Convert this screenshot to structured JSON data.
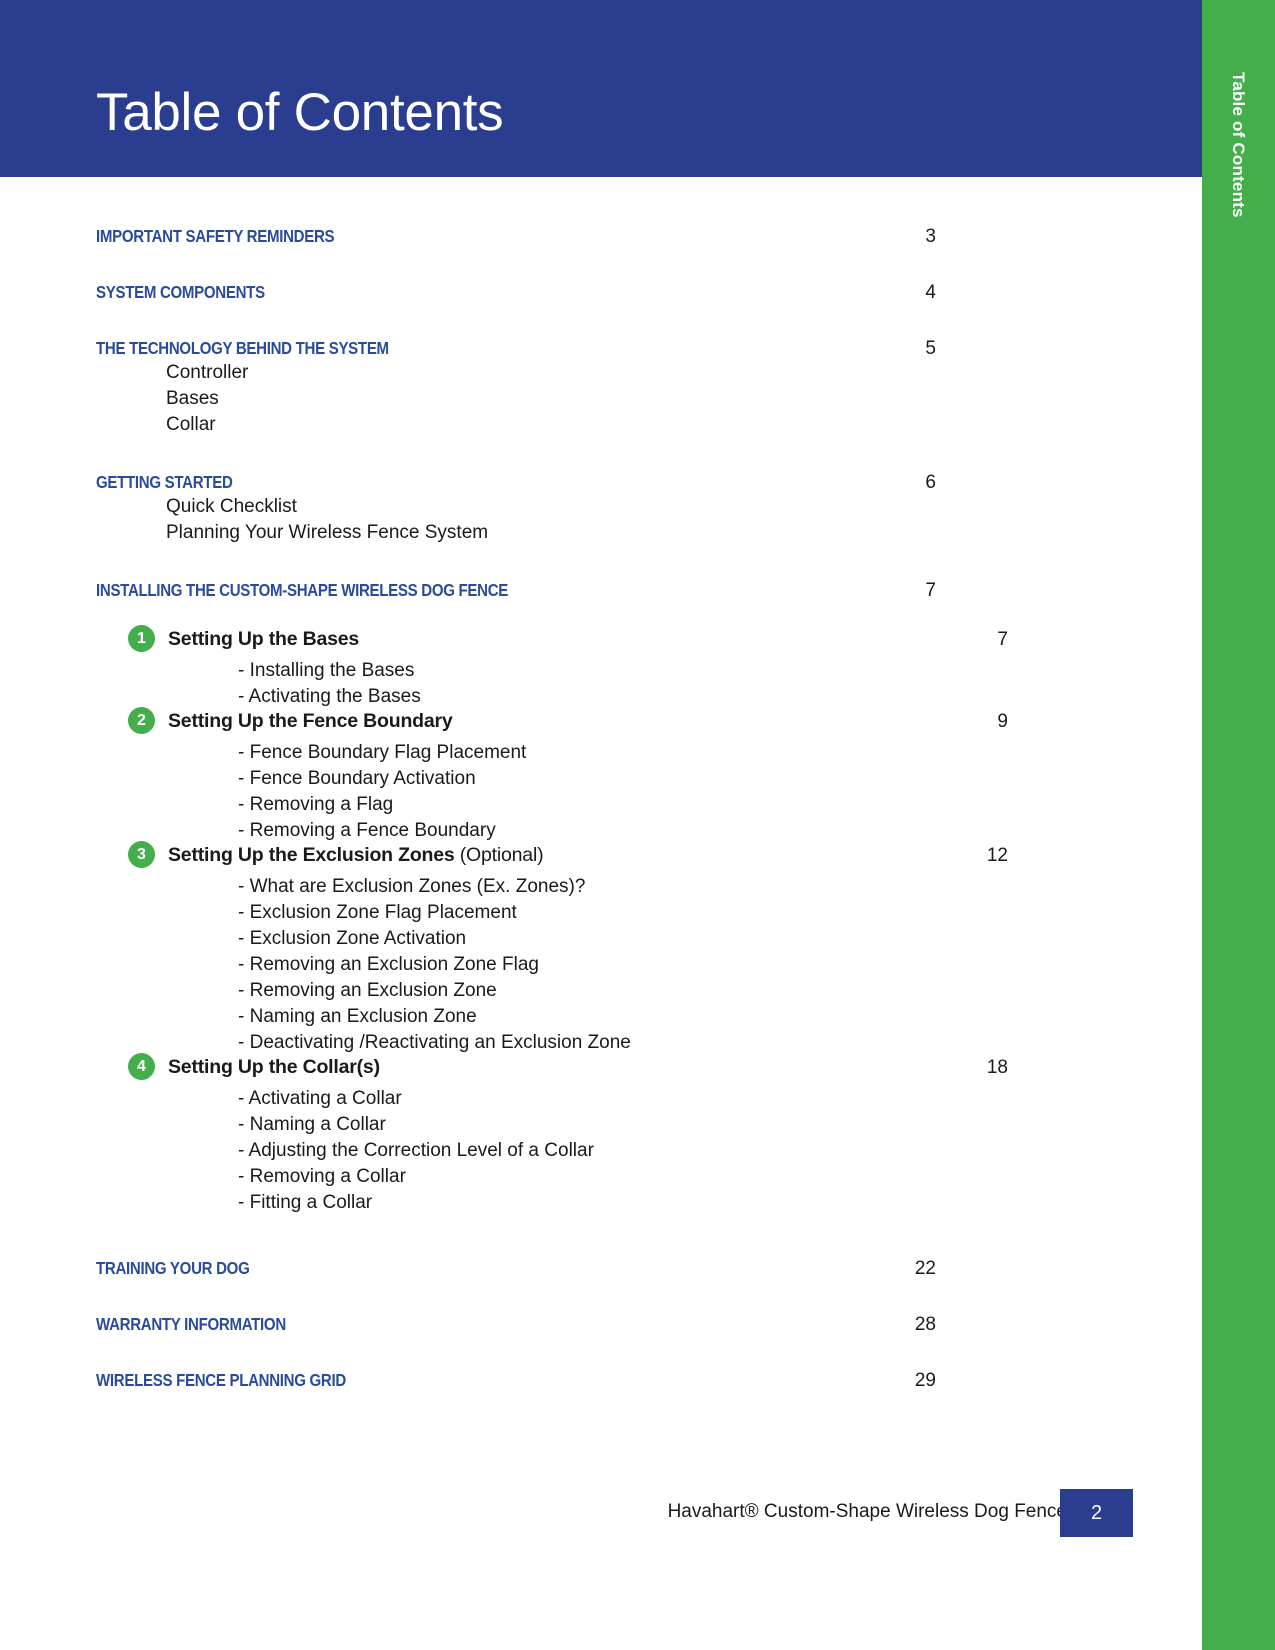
{
  "header": {
    "title": "Table of Contents"
  },
  "side_tab": {
    "label": "Table of Contents"
  },
  "colors": {
    "header_blue": "#2a3d8f",
    "section_blue": "#2a4b9b",
    "badge_green": "#44ae4d",
    "tab_green": "#44ae4d",
    "text_black": "#1a1a1a"
  },
  "toc": {
    "sections": [
      {
        "title": "IMPORTANT SAFETY REMINDERS",
        "page": "3",
        "subs": []
      },
      {
        "title": "SYSTEM COMPONENTS",
        "page": "4",
        "subs": []
      },
      {
        "title": "THE TECHNOLOGY BEHIND THE SYSTEM",
        "page": "5",
        "subs": [
          "Controller",
          "Bases",
          "Collar"
        ]
      },
      {
        "title": "GETTING STARTED",
        "page": "6",
        "subs": [
          "Quick Checklist",
          "Planning Your Wireless Fence System"
        ]
      },
      {
        "title": "INSTALLING THE CUSTOM-SHAPE WIRELESS DOG FENCE",
        "page": "7",
        "subs": []
      }
    ],
    "steps": [
      {
        "number": "1",
        "title": "Setting Up the Bases",
        "optional": "",
        "page": "7",
        "items": [
          "- Installing the Bases",
          "- Activating the Bases"
        ]
      },
      {
        "number": "2",
        "title": "Setting Up the Fence Boundary",
        "optional": "",
        "page": "9",
        "items": [
          "- Fence Boundary Flag Placement",
          "- Fence Boundary Activation",
          "- Removing a Flag",
          "- Removing a Fence Boundary"
        ]
      },
      {
        "number": "3",
        "title": "Setting Up the Exclusion Zones",
        "optional": " (Optional)",
        "page": "12",
        "items": [
          "- What are Exclusion Zones (Ex. Zones)?",
          "- Exclusion Zone Flag Placement",
          "- Exclusion Zone Activation",
          "- Removing an Exclusion Zone Flag",
          "- Removing an Exclusion Zone",
          "- Naming an Exclusion Zone",
          "- Deactivating /Reactivating an Exclusion Zone"
        ]
      },
      {
        "number": "4",
        "title": "Setting Up the Collar(s)",
        "optional": "",
        "page": "18",
        "items": [
          "- Activating a Collar",
          "- Naming a Collar",
          "- Adjusting the Correction Level of a Collar",
          "- Removing a Collar",
          "- Fitting a Collar"
        ]
      }
    ],
    "tail_sections": [
      {
        "title": "TRAINING YOUR DOG",
        "page": "22"
      },
      {
        "title": "WARRANTY INFORMATION",
        "page": "28"
      },
      {
        "title": "WIRELESS FENCE PLANNING GRID",
        "page": "29"
      }
    ]
  },
  "footer": {
    "text": "Havahart® Custom-Shape Wireless Dog Fence",
    "page": "2"
  }
}
